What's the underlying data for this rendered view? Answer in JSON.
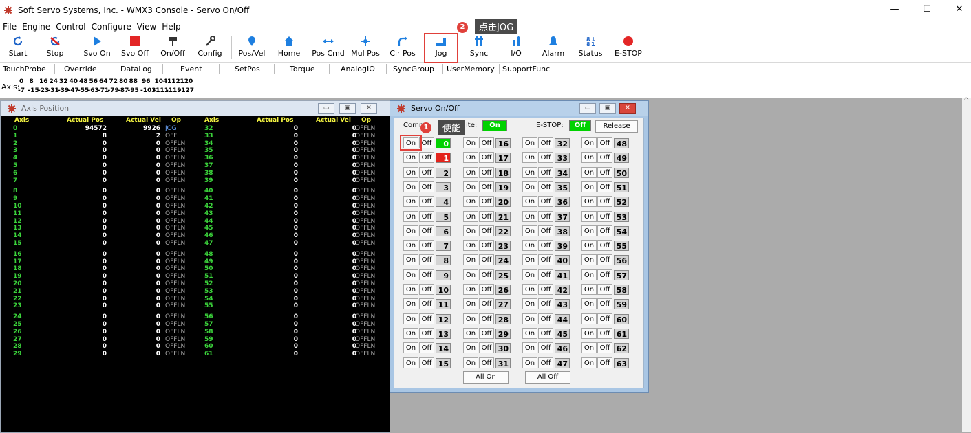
{
  "window": {
    "title": "Soft Servo Systems, Inc. - WMX3 Console - Servo On/Off",
    "min": "—",
    "max": "☐",
    "close": "✕"
  },
  "menu": [
    "File",
    "Engine",
    "Control",
    "Configure",
    "View",
    "Help"
  ],
  "toolbar": [
    {
      "label": "Start",
      "icon": "refresh-icon"
    },
    {
      "label": "Stop",
      "icon": "stop-cycle-icon"
    },
    {
      "label": "Svo On",
      "icon": "play-icon"
    },
    {
      "label": "Svo Off",
      "icon": "square-stop-icon"
    },
    {
      "label": "On/Off",
      "icon": "plug-icon"
    },
    {
      "label": "Config",
      "icon": "wrench-icon"
    },
    {
      "label": "Pos/Vel",
      "icon": "pin-icon"
    },
    {
      "label": "Home",
      "icon": "home-icon"
    },
    {
      "label": "Pos Cmd",
      "icon": "arrows-h-icon"
    },
    {
      "label": "Mul Pos",
      "icon": "arrows-cross-icon"
    },
    {
      "label": "Cir Pos",
      "icon": "arc-arrow-icon"
    },
    {
      "label": "Jog",
      "icon": "jog-icon"
    },
    {
      "label": "Sync",
      "icon": "sync-icon"
    },
    {
      "label": "I/O",
      "icon": "io-icon"
    },
    {
      "label": "Alarm",
      "icon": "bell-icon"
    },
    {
      "label": "Status",
      "icon": "status-icon"
    },
    {
      "label": "E-STOP",
      "icon": "estop-icon"
    }
  ],
  "secondary_tabs": [
    "TouchProbe",
    "Override",
    "DataLog",
    "Event",
    "SetPos",
    "Torque",
    "AnalogIO",
    "SyncGroup",
    "UserMemory",
    "SupportFunc"
  ],
  "axis_bar": {
    "label": "Axis:",
    "top": [
      "0",
      "8",
      "16",
      "24",
      "32",
      "40",
      "48",
      "56",
      "64",
      "72",
      "80",
      "88",
      "96",
      "104",
      "112",
      "120"
    ],
    "bottom": [
      "-7",
      "-15",
      "-23",
      "-31",
      "-39",
      "-47",
      "-55",
      "-63",
      "-71",
      "-79",
      "-87",
      "-95",
      "-103",
      "-111",
      "-119",
      "-127"
    ]
  },
  "axis_position": {
    "title": "Axis Position",
    "headers": [
      "Axis",
      "Actual Pos",
      "Actual Vel",
      "Op",
      "Axis",
      "Actual Pos",
      "Actual Vel",
      "Op"
    ],
    "left": [
      {
        "axis": "0",
        "pos": "94572",
        "vel": "9926",
        "op": "JOG"
      },
      {
        "axis": "1",
        "pos": "8",
        "vel": "2",
        "op": "OFF"
      },
      {
        "axis": "2",
        "pos": "0",
        "vel": "0",
        "op": "OFFLN"
      },
      {
        "axis": "3",
        "pos": "0",
        "vel": "0",
        "op": "OFFLN"
      },
      {
        "axis": "4",
        "pos": "0",
        "vel": "0",
        "op": "OFFLN"
      },
      {
        "axis": "5",
        "pos": "0",
        "vel": "0",
        "op": "OFFLN"
      },
      {
        "axis": "6",
        "pos": "0",
        "vel": "0",
        "op": "OFFLN"
      },
      {
        "axis": "7",
        "pos": "0",
        "vel": "0",
        "op": "OFFLN"
      },
      {
        "axis": "8",
        "pos": "0",
        "vel": "0",
        "op": "OFFLN"
      },
      {
        "axis": "9",
        "pos": "0",
        "vel": "0",
        "op": "OFFLN"
      },
      {
        "axis": "10",
        "pos": "0",
        "vel": "0",
        "op": "OFFLN"
      },
      {
        "axis": "11",
        "pos": "0",
        "vel": "0",
        "op": "OFFLN"
      },
      {
        "axis": "12",
        "pos": "0",
        "vel": "0",
        "op": "OFFLN"
      },
      {
        "axis": "13",
        "pos": "0",
        "vel": "0",
        "op": "OFFLN"
      },
      {
        "axis": "14",
        "pos": "0",
        "vel": "0",
        "op": "OFFLN"
      },
      {
        "axis": "15",
        "pos": "0",
        "vel": "0",
        "op": "OFFLN"
      },
      {
        "axis": "16",
        "pos": "0",
        "vel": "0",
        "op": "OFFLN"
      },
      {
        "axis": "17",
        "pos": "0",
        "vel": "0",
        "op": "OFFLN"
      },
      {
        "axis": "18",
        "pos": "0",
        "vel": "0",
        "op": "OFFLN"
      },
      {
        "axis": "19",
        "pos": "0",
        "vel": "0",
        "op": "OFFLN"
      },
      {
        "axis": "20",
        "pos": "0",
        "vel": "0",
        "op": "OFFLN"
      },
      {
        "axis": "21",
        "pos": "0",
        "vel": "0",
        "op": "OFFLN"
      },
      {
        "axis": "22",
        "pos": "0",
        "vel": "0",
        "op": "OFFLN"
      },
      {
        "axis": "23",
        "pos": "0",
        "vel": "0",
        "op": "OFFLN"
      },
      {
        "axis": "24",
        "pos": "0",
        "vel": "0",
        "op": "OFFLN"
      },
      {
        "axis": "25",
        "pos": "0",
        "vel": "0",
        "op": "OFFLN"
      },
      {
        "axis": "26",
        "pos": "0",
        "vel": "0",
        "op": "OFFLN"
      },
      {
        "axis": "27",
        "pos": "0",
        "vel": "0",
        "op": "OFFLN"
      },
      {
        "axis": "28",
        "pos": "0",
        "vel": "0",
        "op": "OFFLN"
      },
      {
        "axis": "29",
        "pos": "0",
        "vel": "0",
        "op": "OFFLN"
      }
    ],
    "right": [
      {
        "axis": "32",
        "pos": "0",
        "vel": "0",
        "op": "OFFLN"
      },
      {
        "axis": "33",
        "pos": "0",
        "vel": "0",
        "op": "OFFLN"
      },
      {
        "axis": "34",
        "pos": "0",
        "vel": "0",
        "op": "OFFLN"
      },
      {
        "axis": "35",
        "pos": "0",
        "vel": "0",
        "op": "OFFLN"
      },
      {
        "axis": "36",
        "pos": "0",
        "vel": "0",
        "op": "OFFLN"
      },
      {
        "axis": "37",
        "pos": "0",
        "vel": "0",
        "op": "OFFLN"
      },
      {
        "axis": "38",
        "pos": "0",
        "vel": "0",
        "op": "OFFLN"
      },
      {
        "axis": "39",
        "pos": "0",
        "vel": "0",
        "op": "OFFLN"
      },
      {
        "axis": "40",
        "pos": "0",
        "vel": "0",
        "op": "OFFLN"
      },
      {
        "axis": "41",
        "pos": "0",
        "vel": "0",
        "op": "OFFLN"
      },
      {
        "axis": "42",
        "pos": "0",
        "vel": "0",
        "op": "OFFLN"
      },
      {
        "axis": "43",
        "pos": "0",
        "vel": "0",
        "op": "OFFLN"
      },
      {
        "axis": "44",
        "pos": "0",
        "vel": "0",
        "op": "OFFLN"
      },
      {
        "axis": "45",
        "pos": "0",
        "vel": "0",
        "op": "OFFLN"
      },
      {
        "axis": "46",
        "pos": "0",
        "vel": "0",
        "op": "OFFLN"
      },
      {
        "axis": "47",
        "pos": "0",
        "vel": "0",
        "op": "OFFLN"
      },
      {
        "axis": "48",
        "pos": "0",
        "vel": "0",
        "op": "OFFLN"
      },
      {
        "axis": "49",
        "pos": "0",
        "vel": "0",
        "op": "OFFLN"
      },
      {
        "axis": "50",
        "pos": "0",
        "vel": "0",
        "op": "OFFLN"
      },
      {
        "axis": "51",
        "pos": "0",
        "vel": "0",
        "op": "OFFLN"
      },
      {
        "axis": "52",
        "pos": "0",
        "vel": "0",
        "op": "OFFLN"
      },
      {
        "axis": "53",
        "pos": "0",
        "vel": "0",
        "op": "OFFLN"
      },
      {
        "axis": "54",
        "pos": "0",
        "vel": "0",
        "op": "OFFLN"
      },
      {
        "axis": "55",
        "pos": "0",
        "vel": "0",
        "op": "OFFLN"
      },
      {
        "axis": "56",
        "pos": "0",
        "vel": "0",
        "op": "OFFLN"
      },
      {
        "axis": "57",
        "pos": "0",
        "vel": "0",
        "op": "OFFLN"
      },
      {
        "axis": "58",
        "pos": "0",
        "vel": "0",
        "op": "OFFLN"
      },
      {
        "axis": "59",
        "pos": "0",
        "vel": "0",
        "op": "OFFLN"
      },
      {
        "axis": "60",
        "pos": "0",
        "vel": "0",
        "op": "OFFLN"
      },
      {
        "axis": "61",
        "pos": "0",
        "vel": "0",
        "op": "OFFLN"
      }
    ]
  },
  "servo_onoff": {
    "title": "Servo On/Off",
    "comm_label_a": "Comm",
    "comm_label_b": "ite:",
    "comm_state": "On",
    "estop_label": "E-STOP:",
    "estop_state": "Off",
    "release": "Release",
    "on_label": "On",
    "off_label": "Off",
    "axis_states": {
      "0": "green",
      "1": "red"
    },
    "all_on": "All On",
    "all_off": "All Off"
  },
  "annotations": {
    "step1_number": "1",
    "step1_text": "使能",
    "step2_number": "2",
    "step2_text": "点击JOG"
  },
  "colors": {
    "highlight": "#e0403a",
    "on_green": "#00d200",
    "off_red": "#e3231b",
    "axis_green": "#3bd33b",
    "header_yellow": "#f5f542"
  }
}
